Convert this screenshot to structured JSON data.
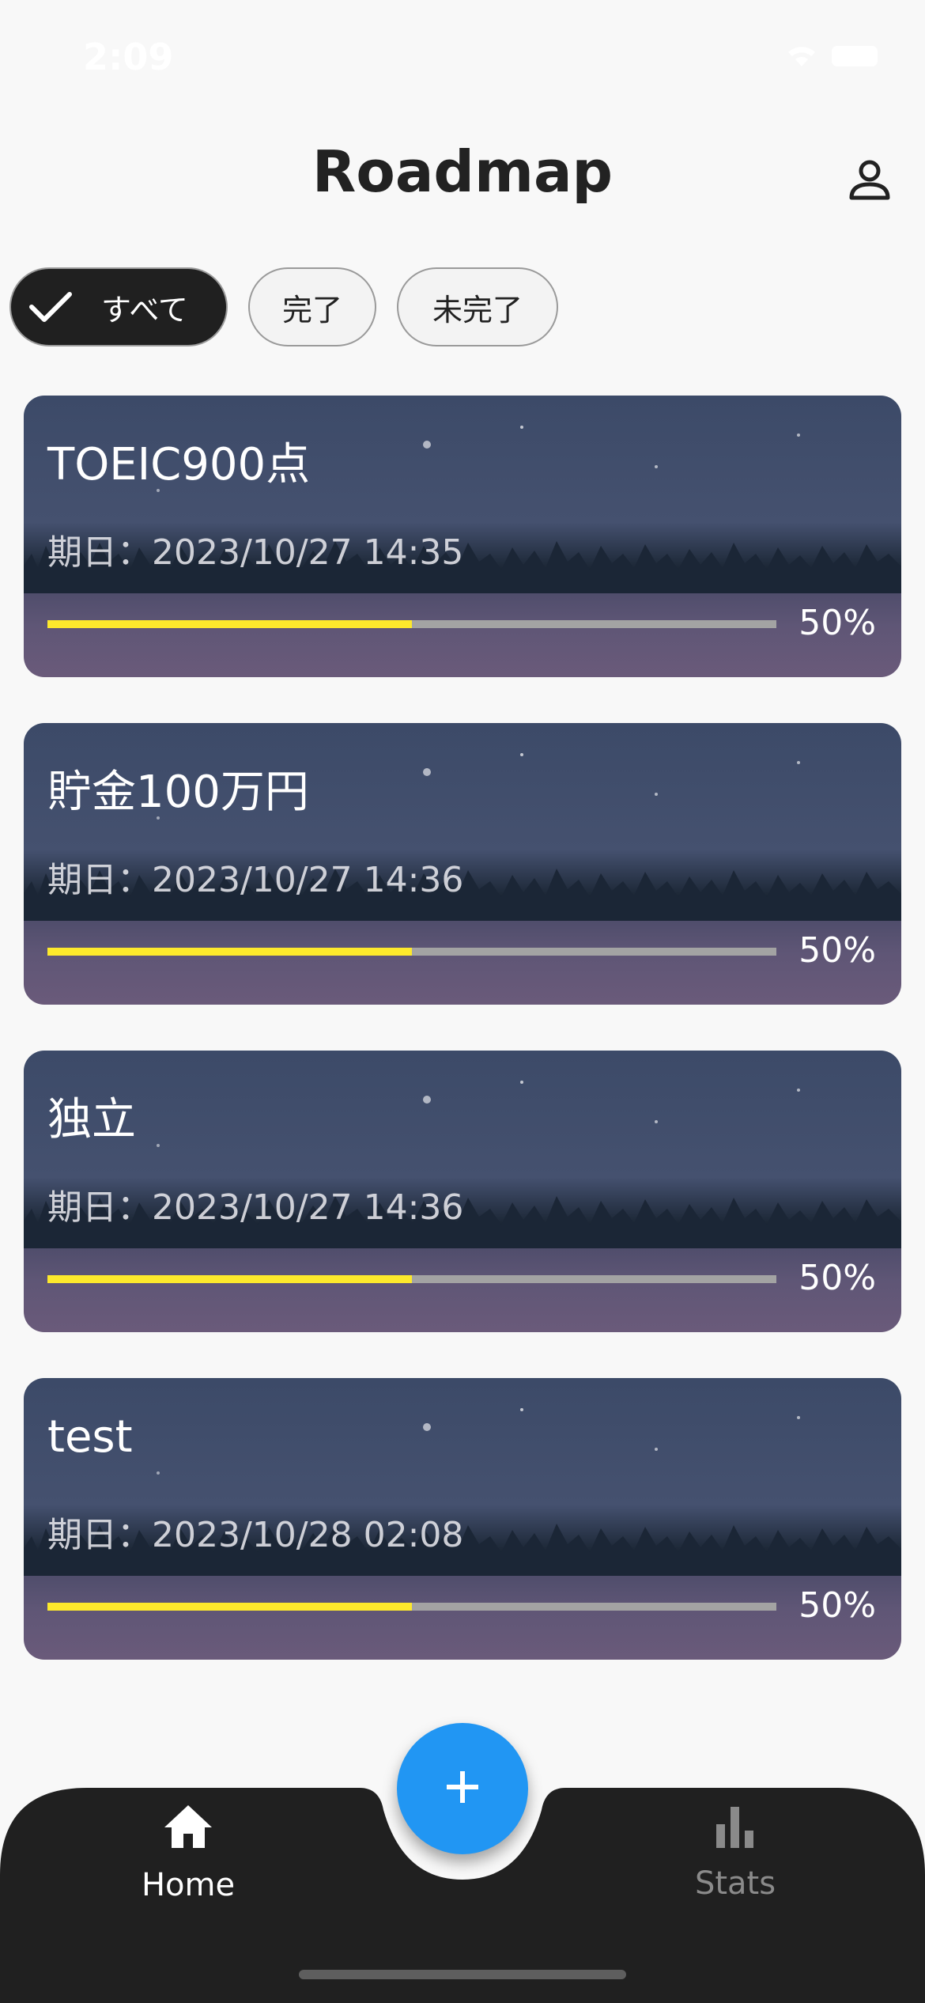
{
  "status_bar": {
    "time": "2:09"
  },
  "header": {
    "title": "Roadmap",
    "profile_icon": "person-outline-icon"
  },
  "filters": [
    {
      "label": "すべて",
      "selected": true
    },
    {
      "label": "完了",
      "selected": false
    },
    {
      "label": "未完了",
      "selected": false
    }
  ],
  "goals": [
    {
      "title": "TOEIC900点",
      "due": "期日：2023/10/27 14:35",
      "progress": 0.5,
      "progress_label": "50%"
    },
    {
      "title": "貯金100万円",
      "due": "期日：2023/10/27 14:36",
      "progress": 0.5,
      "progress_label": "50%"
    },
    {
      "title": "独立",
      "due": "期日：2023/10/27 14:36",
      "progress": 0.5,
      "progress_label": "50%"
    },
    {
      "title": "test",
      "due": "期日：2023/10/28 02:08",
      "progress": 0.5,
      "progress_label": "50%"
    }
  ],
  "bottom_nav": {
    "home_label": "Home",
    "stats_label": "Stats",
    "fab_icon": "plus-icon"
  },
  "colors": {
    "progress_fill": "#fde92c",
    "progress_track": "#a3a3a3",
    "fab": "#2196f3",
    "nav_background": "#202020"
  }
}
